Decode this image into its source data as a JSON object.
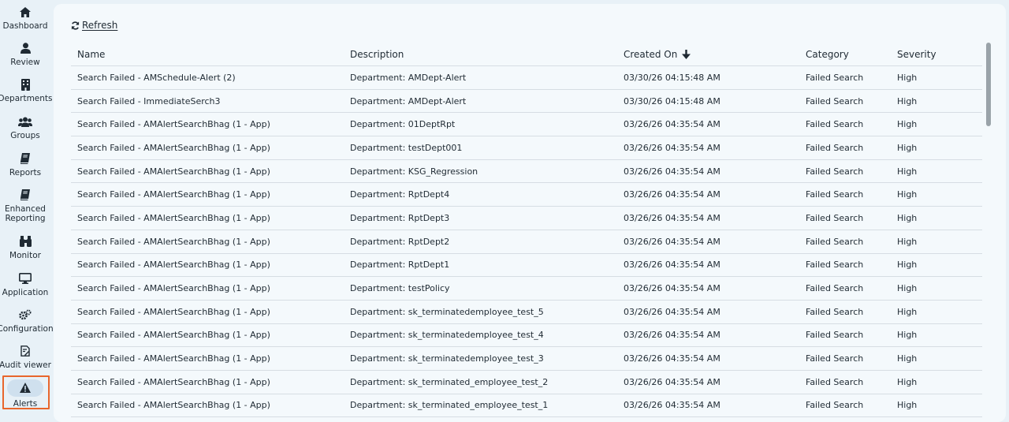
{
  "sidebar": {
    "items": [
      {
        "label": "Dashboard",
        "icon": "home-icon"
      },
      {
        "label": "Review",
        "icon": "user-icon"
      },
      {
        "label": "Departments",
        "icon": "building-icon"
      },
      {
        "label": "Groups",
        "icon": "users-icon"
      },
      {
        "label": "Reports",
        "icon": "book-icon"
      },
      {
        "label": "Enhanced Reporting",
        "icon": "book-icon"
      },
      {
        "label": "Monitor",
        "icon": "binoculars-icon"
      },
      {
        "label": "Application",
        "icon": "monitor-icon"
      },
      {
        "label": "Configuration",
        "icon": "gears-icon"
      },
      {
        "label": "Audit viewer",
        "icon": "document-edit-icon"
      },
      {
        "label": "Alerts",
        "icon": "warning-icon",
        "active": true
      }
    ]
  },
  "toolbar": {
    "refresh_label": "Refresh"
  },
  "table": {
    "columns": [
      "Name",
      "Description",
      "Created On",
      "Category",
      "Severity"
    ],
    "sort_column": "Created On",
    "sort_direction": "descending",
    "rows": [
      [
        "Search Failed - AMSchedule-Alert (2)",
        "Department: AMDept-Alert",
        "03/30/26 04:15:48 AM",
        "Failed Search",
        "High"
      ],
      [
        "Search Failed - ImmediateSerch3",
        "Department: AMDept-Alert",
        "03/30/26 04:15:48 AM",
        "Failed Search",
        "High"
      ],
      [
        "Search Failed - AMAlertSearchBhag (1 - App)",
        "Department: 01DeptRpt",
        "03/26/26 04:35:54 AM",
        "Failed Search",
        "High"
      ],
      [
        "Search Failed - AMAlertSearchBhag (1 - App)",
        "Department: testDept001",
        "03/26/26 04:35:54 AM",
        "Failed Search",
        "High"
      ],
      [
        "Search Failed - AMAlertSearchBhag (1 - App)",
        "Department: KSG_Regression",
        "03/26/26 04:35:54 AM",
        "Failed Search",
        "High"
      ],
      [
        "Search Failed - AMAlertSearchBhag (1 - App)",
        "Department: RptDept4",
        "03/26/26 04:35:54 AM",
        "Failed Search",
        "High"
      ],
      [
        "Search Failed - AMAlertSearchBhag (1 - App)",
        "Department: RptDept3",
        "03/26/26 04:35:54 AM",
        "Failed Search",
        "High"
      ],
      [
        "Search Failed - AMAlertSearchBhag (1 - App)",
        "Department: RptDept2",
        "03/26/26 04:35:54 AM",
        "Failed Search",
        "High"
      ],
      [
        "Search Failed - AMAlertSearchBhag (1 - App)",
        "Department: RptDept1",
        "03/26/26 04:35:54 AM",
        "Failed Search",
        "High"
      ],
      [
        "Search Failed - AMAlertSearchBhag (1 - App)",
        "Department: testPolicy",
        "03/26/26 04:35:54 AM",
        "Failed Search",
        "High"
      ],
      [
        "Search Failed - AMAlertSearchBhag (1 - App)",
        "Department: sk_terminatedemployee_test_5",
        "03/26/26 04:35:54 AM",
        "Failed Search",
        "High"
      ],
      [
        "Search Failed - AMAlertSearchBhag (1 - App)",
        "Department: sk_terminatedemployee_test_4",
        "03/26/26 04:35:54 AM",
        "Failed Search",
        "High"
      ],
      [
        "Search Failed - AMAlertSearchBhag (1 - App)",
        "Department: sk_terminatedemployee_test_3",
        "03/26/26 04:35:54 AM",
        "Failed Search",
        "High"
      ],
      [
        "Search Failed - AMAlertSearchBhag (1 - App)",
        "Department: sk_terminated_employee_test_2",
        "03/26/26 04:35:54 AM",
        "Failed Search",
        "High"
      ],
      [
        "Search Failed - AMAlertSearchBhag (1 - App)",
        "Department: sk_terminated_employee_test_1",
        "03/26/26 04:35:54 AM",
        "Failed Search",
        "High"
      ]
    ]
  },
  "colors": {
    "active_highlight": "#e8662c",
    "background": "#e8f1f7",
    "panel": "#f4f9fc"
  }
}
